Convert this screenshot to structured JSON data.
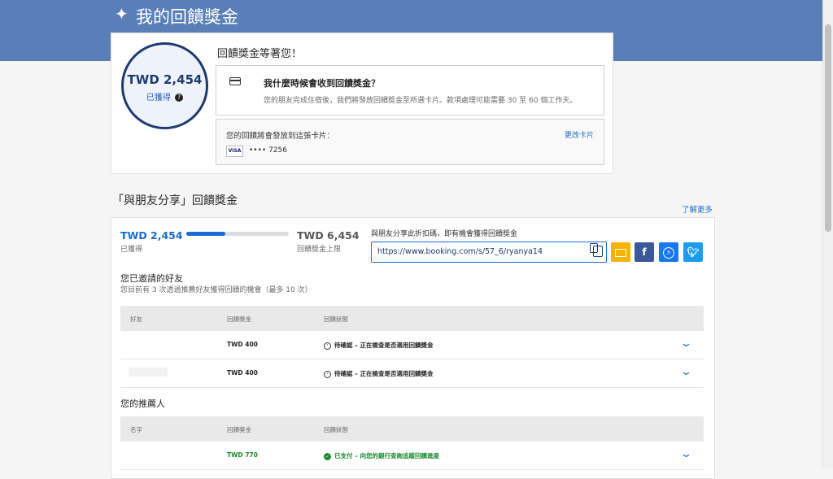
{
  "banner": {
    "title": "我的回饋獎金"
  },
  "summary": {
    "amount": "TWD 2,454",
    "earned_label": "已獲得",
    "waiting_text": "回饋獎金等著您！",
    "question_title": "我什麼時候會收到回饋獎金？",
    "question_desc": "您的朋友完成住宿後，我們將發放回饋獎金至所選卡片。款項處理可能需要 30 至 60 個工作天。",
    "card_label": "您的回饋將會發放到這張卡片：",
    "change_card": "更改卡片",
    "card_brand": "VISA",
    "card_number": "•••• 7256"
  },
  "section": {
    "title": "「與朋友分享」回饋獎金",
    "learn_more": "了解更多"
  },
  "progress": {
    "earned_amount": "TWD 2,454",
    "earned_label": "已獲得",
    "limit_amount": "TWD 6,454",
    "limit_label": "回饋獎金上限",
    "fraction": 0.38
  },
  "share": {
    "label": "與朋友分享此折扣碼，即有機會獲得回饋獎金",
    "link": "https://www.booking.com/s/57_6/ryanya14",
    "buttons": {
      "facebook": "f"
    }
  },
  "invited": {
    "title": "您已邀請的好友",
    "subtitle": "您目前有 3 次透過推薦好友獲得回饋的機會（最多 10 次）",
    "headers": [
      "好友",
      "回饋獎金",
      "回饋狀態"
    ],
    "rows": [
      {
        "amount": "TWD 400",
        "status": "待確認 – 正在檢查是否適用回饋獎金"
      },
      {
        "amount": "TWD 400",
        "status": "待確認 – 正在檢查是否適用回饋獎金"
      }
    ]
  },
  "referrer": {
    "title": "您的推薦人",
    "headers": [
      "名字",
      "回饋獎金",
      "回饋狀態"
    ],
    "rows": [
      {
        "amount": "TWD 770",
        "status": "已支付 – 向您的銀行查詢追蹤回饋進度"
      }
    ]
  },
  "colors": {
    "banner": "#5a7fb8",
    "accent": "#1a6bd1",
    "success": "#1a8a2e"
  }
}
